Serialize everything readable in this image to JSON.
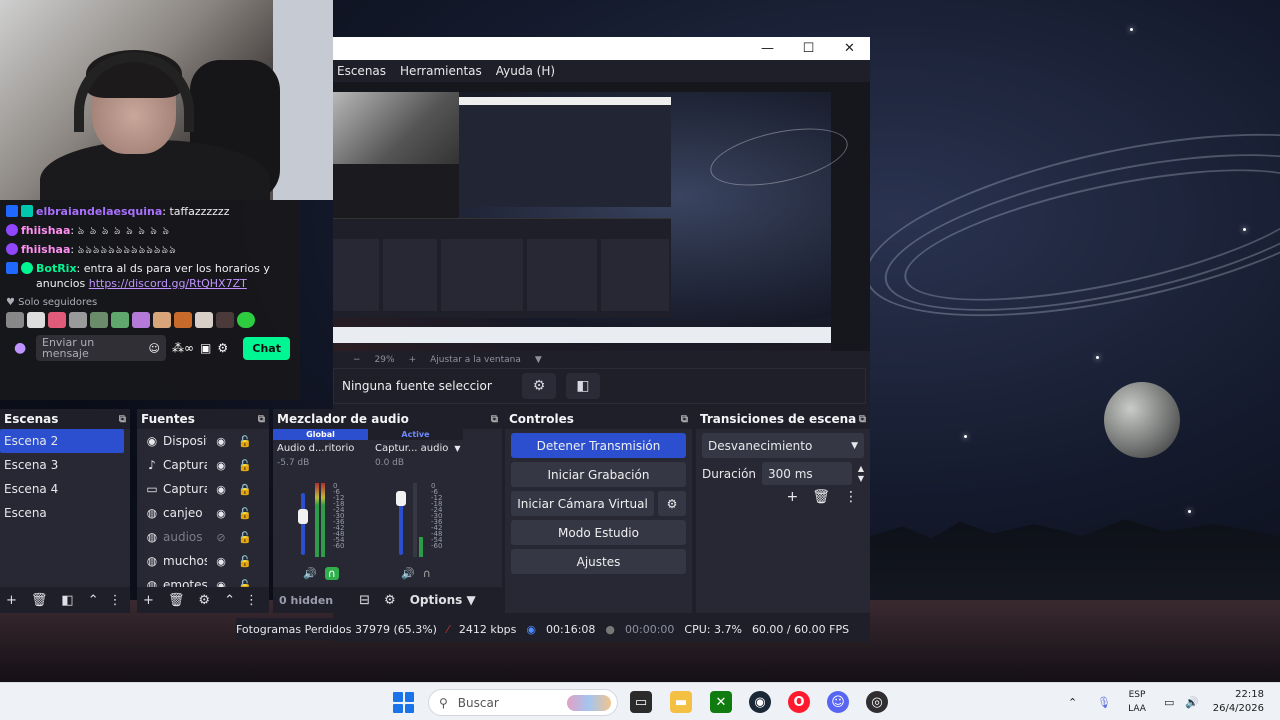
{
  "chat": {
    "messages": [
      {
        "user": "elbraiandelaesquina",
        "user_color": "#a970ff",
        "text": "taffazzzzzz"
      },
      {
        "user": "fhiishaa",
        "user_color": "#ff8ff0",
        "text": "ঌ ঌ ঌ ঌ ঌ ঌ ঌ ঌ"
      },
      {
        "user": "fhiishaa",
        "user_color": "#ff8ff0",
        "text": "ঌঌঌঌঌঌঌঌঌঌঌঌঌ"
      },
      {
        "user": "BotRix",
        "user_color": "#00f593",
        "text": "entra al ds para ver los horarios y anuncios ",
        "link": "https://discord.gg/RtQHX7ZT"
      }
    ],
    "followers_label": "Solo seguidores",
    "input_placeholder": "Enviar un mensaje",
    "chat_button": "Chat"
  },
  "obs": {
    "menu": [
      "Escenas",
      "Herramientas",
      "Ayuda (H)"
    ],
    "zoom": "29%",
    "zoom_fit": "Ajustar a la ventana",
    "no_source": "Ninguna fuente seleccionada",
    "scenes": {
      "title": "Escenas",
      "items": [
        {
          "label": "Escena 2",
          "active": true
        },
        {
          "label": "Escena 3",
          "active": false
        },
        {
          "label": "Escena 4",
          "active": false
        },
        {
          "label": "Escena",
          "active": false
        }
      ]
    },
    "sources": {
      "title": "Fuentes",
      "items": [
        {
          "icon": "camera-icon",
          "glyph": "📷",
          "label": "Dispositivo",
          "visible": true,
          "locked": false
        },
        {
          "icon": "mic-icon",
          "glyph": "🎙",
          "label": "Captura",
          "visible": true,
          "locked": false
        },
        {
          "icon": "monitor-icon",
          "glyph": "▭",
          "label": "Captura",
          "visible": true,
          "locked": true
        },
        {
          "icon": "globe-icon",
          "glyph": "◍",
          "label": "canjeo c",
          "visible": true,
          "locked": false
        },
        {
          "icon": "globe-icon",
          "glyph": "◍",
          "label": "audios c",
          "visible": false,
          "locked": false
        },
        {
          "icon": "globe-icon",
          "glyph": "◍",
          "label": "muchos",
          "visible": true,
          "locked": false
        },
        {
          "icon": "globe-icon",
          "glyph": "◍",
          "label": "emotes",
          "visible": true,
          "locked": false
        }
      ]
    },
    "mixer": {
      "title": "Mezclador de audio",
      "tab_global": "Global",
      "tab_active": "Active",
      "channels": [
        {
          "name": "Audio d...ritorio",
          "db": "-5.7 dB",
          "level": 0.85
        },
        {
          "name": "Captur... audio",
          "db": "0.0 dB",
          "level": 0.3
        }
      ],
      "scale": [
        "0",
        "-6",
        "-12",
        "-18",
        "-24",
        "-30",
        "-36",
        "-42",
        "-48",
        "-54",
        "-60"
      ],
      "hidden": "0 hidden",
      "options": "Options"
    },
    "controls": {
      "title": "Controles",
      "stop_stream": "Detener Transmisión",
      "start_rec": "Iniciar Grabación",
      "virtual_cam": "Iniciar Cámara Virtual",
      "studio": "Modo Estudio",
      "settings": "Ajustes"
    },
    "transitions": {
      "title": "Transiciones de escena",
      "selected": "Desvanecimiento",
      "duration_label": "Duración",
      "duration_value": "300 ms"
    },
    "status": {
      "dropped": "Fotogramas Perdidos 37979 (65.3%)",
      "bitrate": "2412 kbps",
      "live_time": "00:16:08",
      "rec_time": "00:00:00",
      "cpu": "CPU: 3.7%",
      "fps": "60.00 / 60.00 FPS"
    }
  },
  "taskbar": {
    "search_placeholder": "Buscar",
    "lang_top": "ESP",
    "lang_bottom": "LAA",
    "time": "22:18",
    "date": "26/4/2026"
  },
  "colors": {
    "accent": "#2b4fce",
    "twitch_green": "#00f593",
    "dock_bg": "#272833"
  }
}
